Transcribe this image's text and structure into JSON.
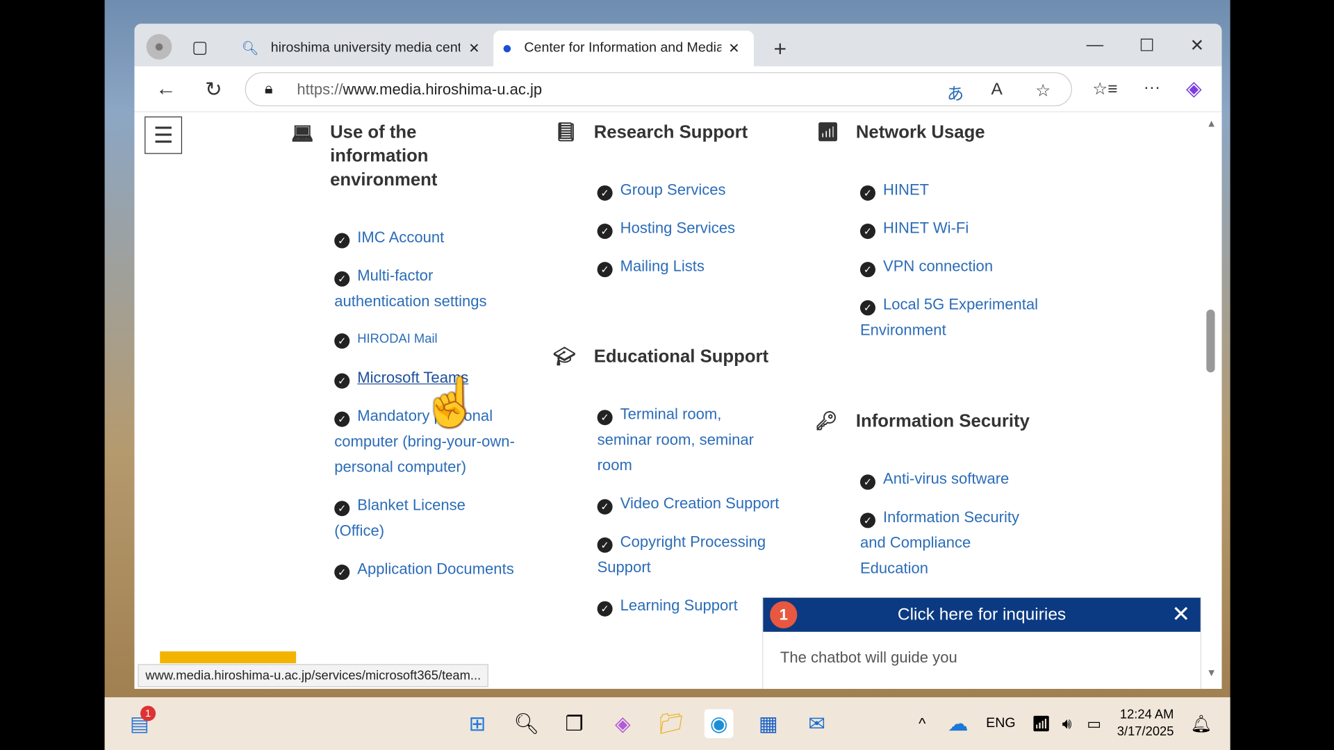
{
  "browser": {
    "tabs": [
      {
        "label": "hiroshima university media center",
        "icon": "search-icon"
      },
      {
        "label": "Center for Information and Media",
        "icon": "site-logo-icon",
        "active": true
      }
    ],
    "url_prefix": "https://",
    "url_host": "www.media.hiroshima-u.ac.jp",
    "status_url": "www.media.hiroshima-u.ac.jp/services/microsoft365/team..."
  },
  "page": {
    "columns": [
      {
        "title": "Use of the information environment",
        "icon": "laptop-icon",
        "items": [
          "IMC Account",
          "Multi-factor authentication settings",
          "HIRODAI Mail",
          "Microsoft Teams",
          "Mandatory personal computer (bring-your-own-personal computer)",
          "Blanket License (Office)",
          "Application Documents"
        ]
      },
      {
        "title": "Research Support",
        "icon": "book-icon",
        "items": [
          "Group Services",
          "Hosting Services",
          "Mailing Lists"
        ]
      },
      {
        "title": "Educational Support",
        "icon": "graduation-cap-icon",
        "items": [
          "Terminal room, seminar room, seminar room",
          "Video Creation Support",
          "Copyright Processing Support",
          "Learning Support"
        ]
      },
      {
        "title": "Network Usage",
        "icon": "wifi-icon",
        "items": [
          "HINET",
          "HINET Wi-Fi",
          "VPN connection",
          "Local 5G Experimental Environment"
        ]
      },
      {
        "title": "Information Security",
        "icon": "key-icon",
        "items": [
          "Anti-virus software",
          "Information Security and Compliance Education"
        ]
      }
    ],
    "chat": {
      "badge": "1",
      "title": "Click here for inquiries",
      "body": "The chatbot will guide you"
    }
  },
  "taskbar": {
    "badge": "1",
    "lang": "ENG",
    "time": "12:24 AM",
    "date": "3/17/2025"
  },
  "colors": {
    "link": "#2b6cb8",
    "chat_header": "#0b3a82"
  }
}
